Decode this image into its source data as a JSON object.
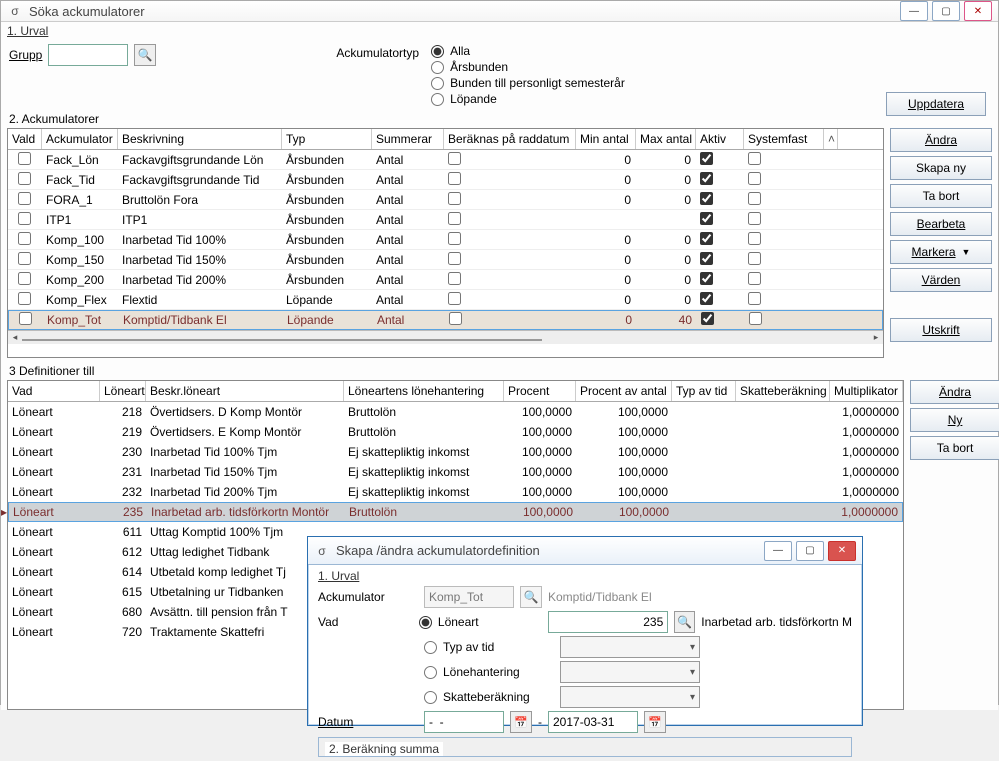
{
  "window": {
    "title": "Söka ackumulatorer",
    "icon": "oO",
    "section1": "1. Urval",
    "grupp_label": "Grupp",
    "accum_type_label": "Ackumulatortyp",
    "radios": [
      "Alla",
      "Årsbunden",
      "Bunden till personligt semesterår",
      "Löpande"
    ],
    "update_btn": "Uppdatera"
  },
  "grid1": {
    "title": "2. Ackumulatorer",
    "cols": [
      "Vald",
      "Ackumulator",
      "Beskrivning",
      "Typ",
      "Summerar",
      "Beräknas på raddatum",
      "Min antal",
      "Max antal",
      "Aktiv",
      "Systemfast"
    ],
    "rows": [
      {
        "vald": false,
        "ack": "Fack_Lön",
        "besk": "Fackavgiftsgrundande Lön",
        "typ": "Årsbunden",
        "sum": "Antal",
        "ber": false,
        "min": "0",
        "max": "0",
        "aktiv": true,
        "sys": false
      },
      {
        "vald": false,
        "ack": "Fack_Tid",
        "besk": "Fackavgiftsgrundande Tid",
        "typ": "Årsbunden",
        "sum": "Antal",
        "ber": false,
        "min": "0",
        "max": "0",
        "aktiv": true,
        "sys": false
      },
      {
        "vald": false,
        "ack": "FORA_1",
        "besk": "Bruttolön Fora",
        "typ": "Årsbunden",
        "sum": "Antal",
        "ber": false,
        "min": "0",
        "max": "0",
        "aktiv": true,
        "sys": false
      },
      {
        "vald": false,
        "ack": "ITP1",
        "besk": "ITP1",
        "typ": "Årsbunden",
        "sum": "Antal",
        "ber": false,
        "min": "",
        "max": "",
        "aktiv": true,
        "sys": false
      },
      {
        "vald": false,
        "ack": "Komp_100",
        "besk": "Inarbetad Tid 100%",
        "typ": "Årsbunden",
        "sum": "Antal",
        "ber": false,
        "min": "0",
        "max": "0",
        "aktiv": true,
        "sys": false
      },
      {
        "vald": false,
        "ack": "Komp_150",
        "besk": "Inarbetad Tid 150%",
        "typ": "Årsbunden",
        "sum": "Antal",
        "ber": false,
        "min": "0",
        "max": "0",
        "aktiv": true,
        "sys": false
      },
      {
        "vald": false,
        "ack": "Komp_200",
        "besk": "Inarbetad Tid 200%",
        "typ": "Årsbunden",
        "sum": "Antal",
        "ber": false,
        "min": "0",
        "max": "0",
        "aktiv": true,
        "sys": false
      },
      {
        "vald": false,
        "ack": "Komp_Flex",
        "besk": "Flextid",
        "typ": "Löpande",
        "sum": "Antal",
        "ber": false,
        "min": "0",
        "max": "0",
        "aktiv": true,
        "sys": false
      },
      {
        "vald": false,
        "ack": "Komp_Tot",
        "besk": "Komptid/Tidbank El",
        "typ": "Löpande",
        "sum": "Antal",
        "ber": false,
        "min": "0",
        "max": "40",
        "aktiv": true,
        "sys": false,
        "selected": true
      }
    ],
    "buttons": [
      "Ändra",
      "Skapa ny",
      "Ta bort",
      "Bearbeta",
      "Markera",
      "Värden"
    ],
    "print_btn": "Utskrift"
  },
  "defs": {
    "title": "3 Definitioner till",
    "cols": [
      "Vad",
      "Löneart",
      "Beskr.löneart",
      "Löneartens lönehantering",
      "Procent",
      "Procent av antal",
      "Typ av tid",
      "Skatteberäkning",
      "Multiplikator"
    ],
    "rows": [
      {
        "vad": "Löneart",
        "lon": "218",
        "besk": "Övertidsers. D Komp Montör",
        "han": "Bruttolön",
        "proc": "100,0000",
        "pav": "100,0000",
        "mult": "1,0000000"
      },
      {
        "vad": "Löneart",
        "lon": "219",
        "besk": "Övertidsers. E Komp Montör",
        "han": "Bruttolön",
        "proc": "100,0000",
        "pav": "100,0000",
        "mult": "1,0000000"
      },
      {
        "vad": "Löneart",
        "lon": "230",
        "besk": "Inarbetad Tid 100% Tjm",
        "han": "Ej skattepliktig inkomst",
        "proc": "100,0000",
        "pav": "100,0000",
        "mult": "1,0000000"
      },
      {
        "vad": "Löneart",
        "lon": "231",
        "besk": "Inarbetad Tid 150% Tjm",
        "han": "Ej skattepliktig inkomst",
        "proc": "100,0000",
        "pav": "100,0000",
        "mult": "1,0000000"
      },
      {
        "vad": "Löneart",
        "lon": "232",
        "besk": "Inarbetad Tid 200% Tjm",
        "han": "Ej skattepliktig inkomst",
        "proc": "100,0000",
        "pav": "100,0000",
        "mult": "1,0000000"
      },
      {
        "vad": "Löneart",
        "lon": "235",
        "besk": "Inarbetad arb. tidsförkortn Montör",
        "han": "Bruttolön",
        "proc": "100,0000",
        "pav": "100,0000",
        "mult": "1,0000000",
        "selected": true
      },
      {
        "vad": "Löneart",
        "lon": "611",
        "besk": "Uttag Komptid 100% Tjm"
      },
      {
        "vad": "Löneart",
        "lon": "612",
        "besk": "Uttag ledighet Tidbank"
      },
      {
        "vad": "Löneart",
        "lon": "614",
        "besk": "Utbetald komp ledighet Tj"
      },
      {
        "vad": "Löneart",
        "lon": "615",
        "besk": "Utbetalning ur Tidbanken"
      },
      {
        "vad": "Löneart",
        "lon": "680",
        "besk": "Avsättn. till pension från T"
      },
      {
        "vad": "Löneart",
        "lon": "720",
        "besk": "Traktamente Skattefri"
      }
    ],
    "buttons": [
      "Ändra",
      "Ny",
      "Ta bort"
    ]
  },
  "dialog": {
    "title": "Skapa /ändra ackumulatordefinition",
    "s1": "1. Urval",
    "ack_label": "Ackumulator",
    "ack_value": "Komp_Tot",
    "ack_desc": "Komptid/Tidbank El",
    "vad_label": "Vad",
    "radios": [
      "Löneart",
      "Typ av tid",
      "Lönehantering",
      "Skatteberäkning"
    ],
    "vad_value": "235",
    "vad_desc": "Inarbetad arb. tidsförkortn M",
    "datum_label": "Datum",
    "datum_from": "-  -",
    "datum_to": "2017-03-31",
    "s2": "2. Beräkning summa"
  }
}
